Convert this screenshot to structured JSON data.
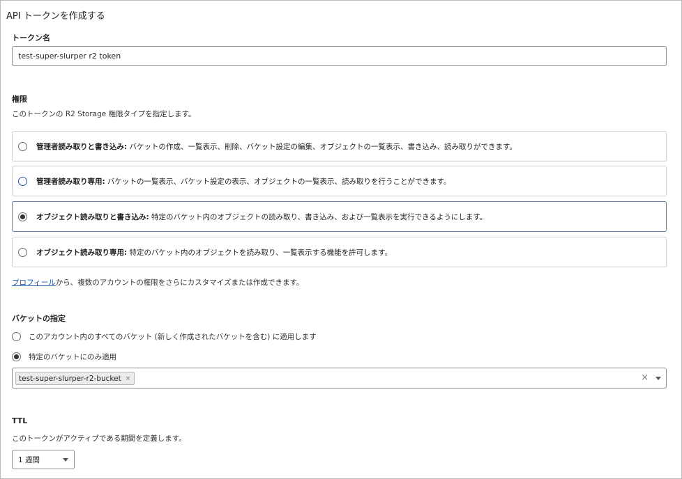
{
  "page": {
    "title": "API トークンを作成する"
  },
  "token_name": {
    "label": "トークン名",
    "value": "test-super-slurper r2 token"
  },
  "permissions": {
    "label": "権限",
    "description": "このトークンの R2 Storage 権限タイプを指定します。",
    "options": [
      {
        "title": "管理者読み取りと書き込み:",
        "description": " バケットの作成、一覧表示、削除、バケット設定の編集、オブジェクトの一覧表示、書き込み、読み取りができます。",
        "selected": false
      },
      {
        "title": "管理者読み取り専用:",
        "description": " バケットの一覧表示、バケット設定の表示、オブジェクトの一覧表示、読み取りを行うことができます。",
        "selected": false
      },
      {
        "title": "オブジェクト読み取りと書き込み:",
        "description": " 特定のバケット内のオブジェクトの読み取り、書き込み、および一覧表示を実行できるようにします。",
        "selected": true
      },
      {
        "title": "オブジェクト読み取り専用:",
        "description": " 特定のバケット内のオブジェクトを読み取り、一覧表示する機能を許可します。",
        "selected": false
      }
    ],
    "profile_link": "プロフィール",
    "profile_note": "から、複数のアカウントの権限をさらにカスタマイズまたは作成できます。"
  },
  "bucket": {
    "label": "バケットの指定",
    "options": [
      {
        "label": "このアカウント内のすべてのバケット (新しく作成されたバケットを含む) に適用します",
        "selected": false
      },
      {
        "label": "特定のバケットにのみ適用",
        "selected": true
      }
    ],
    "selected_chip": "test-super-slurper-r2-bucket",
    "chip_remove": "×",
    "clear_icon": "×"
  },
  "ttl": {
    "label": "TTL",
    "description": "このトークンがアクティブである期間を定義します。",
    "value": "1 週間"
  }
}
